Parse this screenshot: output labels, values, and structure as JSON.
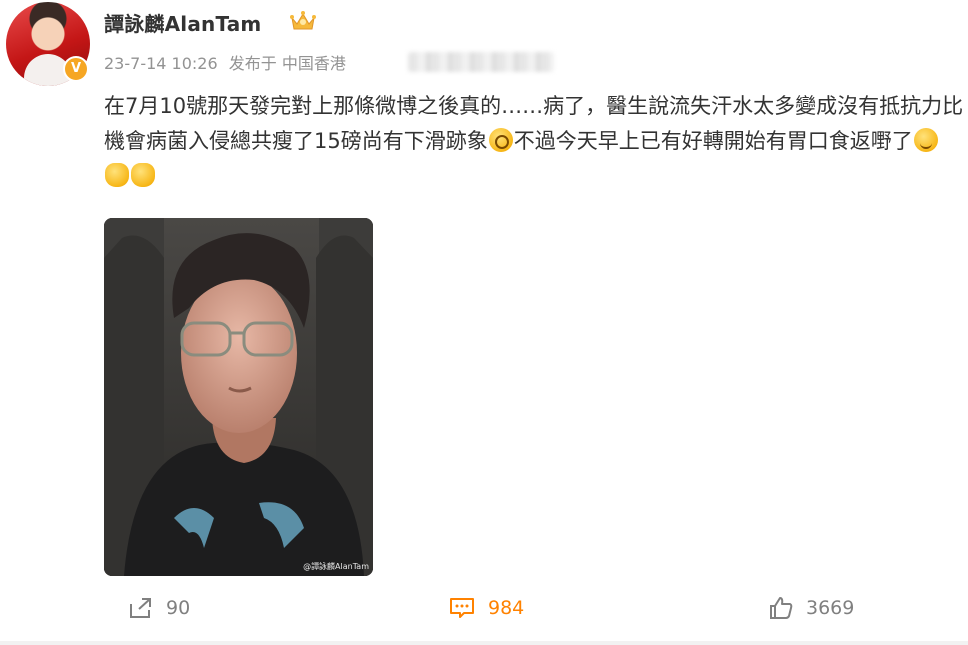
{
  "post": {
    "author": "譚詠麟AlanTam",
    "timestamp": "23-7-14 10:26",
    "source": "发布于 中国香港",
    "content": {
      "part1": "在7月10號那天發完對上那條微博之後真的……病了，醫生說流失汗水太多變成沒有抵抗力比機會病菌入侵總共瘦了15磅尚有下滑跡象",
      "part2": "不過今天早上已有好轉開始有胃口食返嘢了"
    },
    "emojis": [
      "dizzy-face-emoji",
      "wink-emoji",
      "flexed-biceps-emoji",
      "ok-hand-emoji"
    ],
    "image_watermark": "@譚詠麟AlanTam"
  },
  "actions": {
    "repost_count": "90",
    "comment_count": "984",
    "like_count": "3669"
  },
  "colors": {
    "accent": "#ff8200",
    "badge": "#f6a623",
    "text": "#333333",
    "muted": "#939393"
  }
}
